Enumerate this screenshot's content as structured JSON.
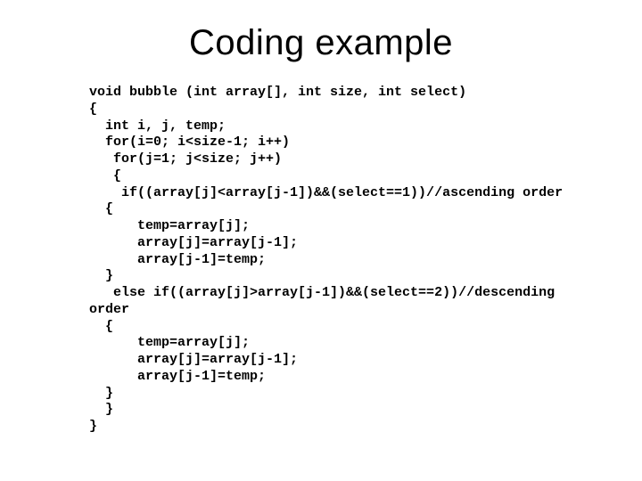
{
  "title": "Coding example",
  "code_lines": [
    "void bubble (int array[], int size, int select)",
    "{",
    "  int i, j, temp;",
    "  for(i=0; i<size-1; i++)",
    "   for(j=1; j<size; j++)",
    "   {",
    "    if((array[j]<array[j-1])&&(select==1))//ascending order",
    "  {",
    "      temp=array[j];",
    "      array[j]=array[j-1];",
    "      array[j-1]=temp;",
    "  }",
    "   else if((array[j]>array[j-1])&&(select==2))//descending",
    "order",
    "  {",
    "      temp=array[j];",
    "      array[j]=array[j-1];",
    "      array[j-1]=temp;",
    "  }",
    "  }",
    "}"
  ]
}
